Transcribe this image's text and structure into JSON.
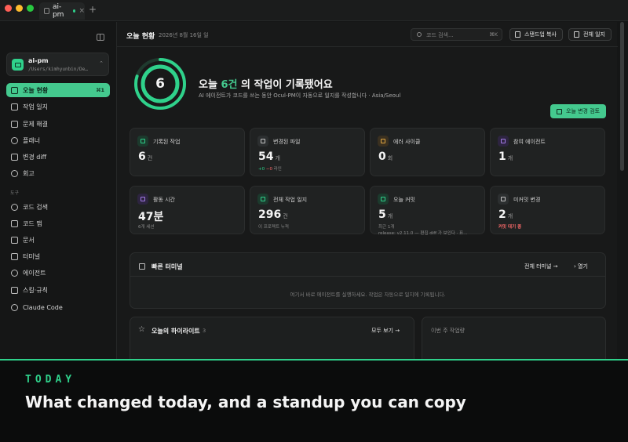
{
  "window": {
    "tab_label": "ai-pm",
    "tab_close": "×",
    "new_tab": "+",
    "traffic_colors": [
      "#ff5f57",
      "#febc2e",
      "#28c840"
    ]
  },
  "sidebar": {
    "project": {
      "name": "ai-pm",
      "path": "/Users/kimhyunbin/De…",
      "chevron": "⌃"
    },
    "items": [
      {
        "label": "오늘 현황",
        "shortcut": "⌘1",
        "active": true
      },
      {
        "label": "작업 일지"
      },
      {
        "label": "문제 해결"
      },
      {
        "label": "플래너"
      },
      {
        "label": "변경 diff"
      },
      {
        "label": "회고"
      }
    ],
    "tools_label": "도구",
    "tools": [
      {
        "label": "코드 검색"
      },
      {
        "label": "코드 맵"
      },
      {
        "label": "문서"
      },
      {
        "label": "터미널"
      },
      {
        "label": "에이전트"
      },
      {
        "label": "스킬·규칙"
      },
      {
        "label": "Claude Code"
      }
    ]
  },
  "header": {
    "title": "오늘 현황",
    "date": "2026년 8월 16일 일",
    "search_placeholder": "코드 검색...",
    "search_kbd": "⌘K",
    "standup_button": "스탠드업 복사",
    "all_logs_button": "전체 일지"
  },
  "hero": {
    "count": "6",
    "progress": 0.8,
    "title_prefix": "오늘",
    "title_highlight": "6건",
    "title_suffix": "의 작업이 기록됐어요",
    "subtitle": "AI 에이전트가 코드를 쓰는 동안 Ocul-PM이 자동으로 일지를 작성합니다 · Asia/Seoul",
    "review_button": "오늘 변경 검토"
  },
  "stats": [
    {
      "label": "기록된 작업",
      "value": "6",
      "unit": "건",
      "sub": "",
      "icon_color": "#2fd18b"
    },
    {
      "label": "변경된 파일",
      "value": "54",
      "unit": "개",
      "sub_plus": "+0",
      "sub_minus": "−0",
      "sub_tail": "라인",
      "icon_color": "#9aa0a6"
    },
    {
      "label": "에러 사이클",
      "value": "0",
      "unit": "회",
      "sub": "",
      "icon_color": "#e0a640"
    },
    {
      "label": "참여 에이전트",
      "value": "1",
      "unit": "개",
      "sub": "",
      "icon_color": "#a47be8"
    },
    {
      "label": "활동 시간",
      "value": "47분",
      "unit": "",
      "sub": "6개 세션",
      "icon_color": "#a47be8"
    },
    {
      "label": "전체 작업 일지",
      "value": "296",
      "unit": "건",
      "sub": "이 프로젝트 누적",
      "icon_color": "#2fd18b"
    },
    {
      "label": "오늘 커밋",
      "value": "5",
      "unit": "개",
      "sub": "최근 1개",
      "sub2": "release: v2.11.0 — 편집 diff 가 보인다 · 표…",
      "icon_color": "#2fd18b"
    },
    {
      "label": "미커밋 변경",
      "value": "2",
      "unit": "개",
      "sub_alert": "커밋 대기 중",
      "icon_color": "#9aa0a6"
    }
  ],
  "terminal_panel": {
    "title": "빠른 터미널",
    "link_all": "전체 터미널 →",
    "link_open": "› 열기",
    "empty": "여기서 바로 에이전트를 실행하세요. 작업은 자동으로 일지에 기록됩니다."
  },
  "highlights_panel": {
    "title": "오늘의 하이라이트",
    "count": "3",
    "link": "모두 보기 →"
  },
  "week_panel": {
    "title": "이번 주 작업량"
  },
  "caption": {
    "kicker": "TODAY",
    "title": "What changed today, and a standup you can copy"
  },
  "accent": "#2fd18b"
}
